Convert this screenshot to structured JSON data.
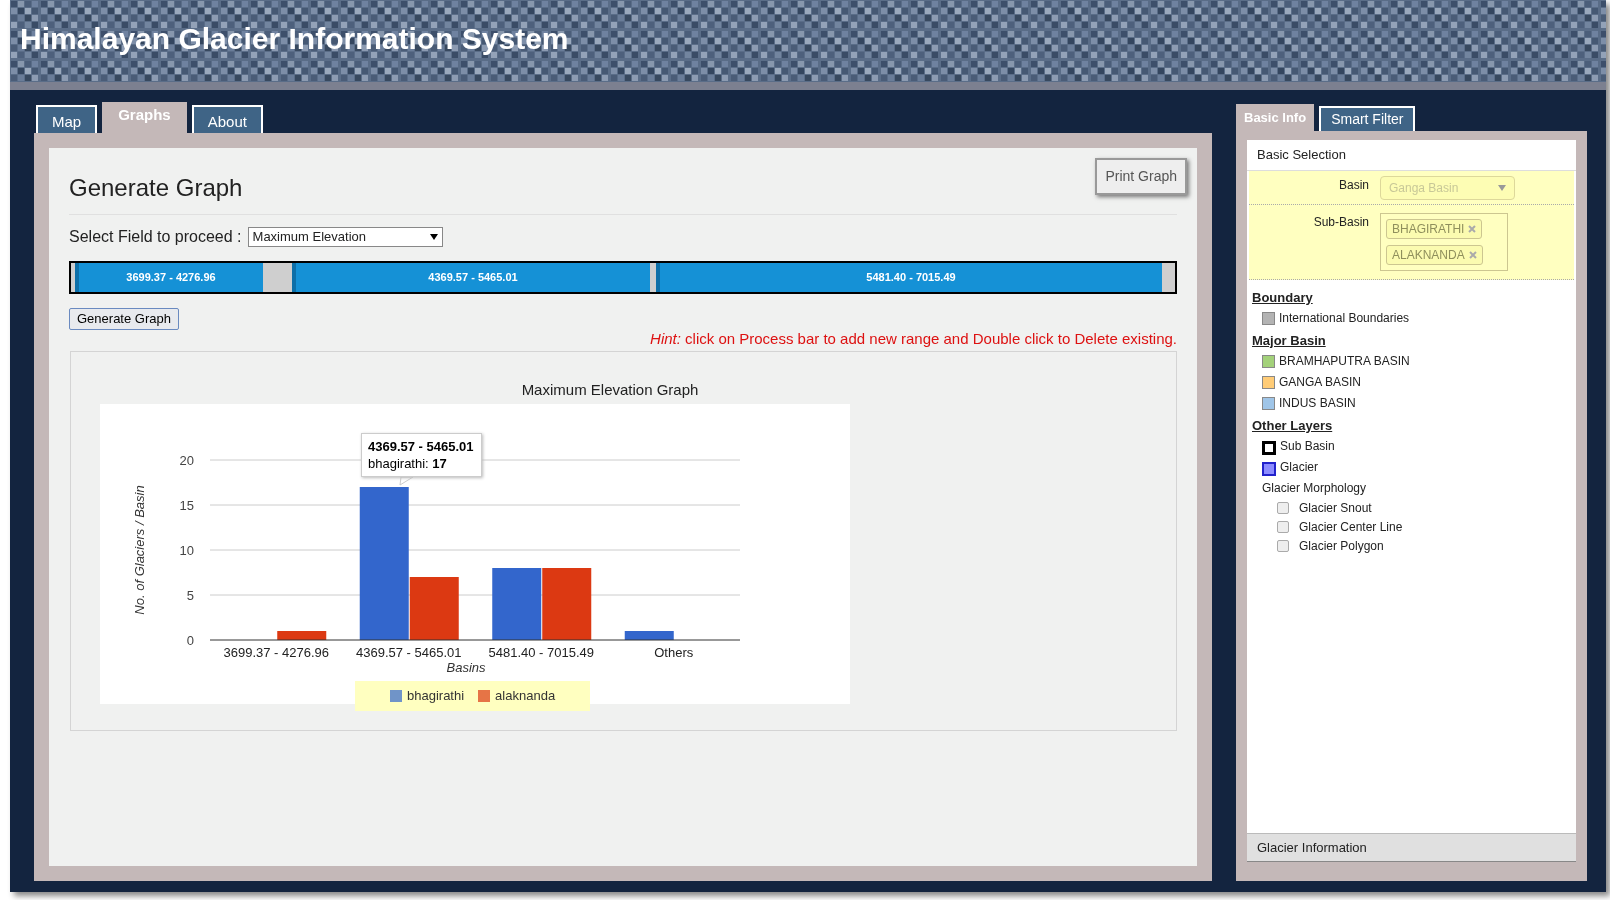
{
  "header": {
    "title": "Himalayan Glacier Information System"
  },
  "tabs": [
    {
      "label": "Map",
      "selected": false
    },
    {
      "label": "Graphs",
      "selected": true
    },
    {
      "label": "About",
      "selected": false
    }
  ],
  "graph_panel": {
    "title": "Generate Graph",
    "print_button": "Print Graph",
    "field_label": "Select Field to proceed :",
    "field_value": "Maximum Elevation",
    "ranges": [
      "3699.37 - 4276.96",
      "4369.57 - 5465.01",
      "5481.40 - 7015.49"
    ],
    "generate_button": "Generate Graph",
    "hint": "*Hint:* click on Process bar to add new range and Double click to Delete existing.",
    "chart_data": {
      "type": "bar",
      "title": "Maximum Elevation Graph",
      "xlabel": "Basins",
      "ylabel": "No. of Glaciers / Basin",
      "categories": [
        "3699.37 - 4276.96",
        "4369.57 - 5465.01",
        "5481.40 - 7015.49",
        "Others"
      ],
      "series": [
        {
          "name": "bhagirathi",
          "color": "#3366cc",
          "values": [
            0,
            17,
            8,
            1
          ]
        },
        {
          "name": "alaknanda",
          "color": "#dc3912",
          "values": [
            1,
            7,
            8,
            0
          ]
        }
      ],
      "ylim": [
        0,
        20
      ],
      "yticks": [
        0,
        5,
        10,
        15,
        20
      ],
      "grid": true,
      "legend": true
    },
    "tooltip": {
      "title": "4369.57 - 5465.01",
      "body": "bhagirathi: **17**"
    }
  },
  "side_tabs": [
    {
      "label": "Basic Info",
      "selected": true
    },
    {
      "label": "Smart Filter",
      "selected": false
    }
  ],
  "basic_selection": {
    "title": "Basic Selection",
    "basin_label": "Basin",
    "basin_value": "Ganga Basin",
    "sub_basin_label": "Sub-Basin",
    "sub_basins": [
      "BHAGIRATHI",
      "ALAKNANDA"
    ],
    "disabled": true
  },
  "layers": [
    {
      "heading": "Boundary",
      "items": [
        {
          "kind": "swatch",
          "label": "International Boundaries",
          "color": "#b3b3b3"
        }
      ]
    },
    {
      "heading": "Major Basin",
      "items": [
        {
          "kind": "swatch",
          "label": "BRAMHAPUTRA BASIN",
          "color": "#a3d17a"
        },
        {
          "kind": "swatch",
          "label": "GANGA BASIN",
          "color": "#ffcc77"
        },
        {
          "kind": "swatch",
          "label": "INDUS BASIN",
          "color": "#9fc5e8"
        }
      ]
    },
    {
      "heading": "Other Layers",
      "items": [
        {
          "kind": "outline",
          "label": "Sub Basin",
          "color": "#000000"
        },
        {
          "kind": "fill",
          "label": "Glacier",
          "color": "#8c8cff"
        },
        {
          "kind": "group",
          "label": "Glacier Morphology",
          "children": [
            {
              "kind": "checkbox",
              "label": "Glacier Snout",
              "checked": false
            },
            {
              "kind": "checkbox",
              "label": "Glacier Center Line",
              "checked": false
            },
            {
              "kind": "checkbox",
              "label": "Glacier Polygon",
              "checked": false
            }
          ]
        }
      ]
    }
  ],
  "footer": {
    "title": "Glacier Information"
  }
}
